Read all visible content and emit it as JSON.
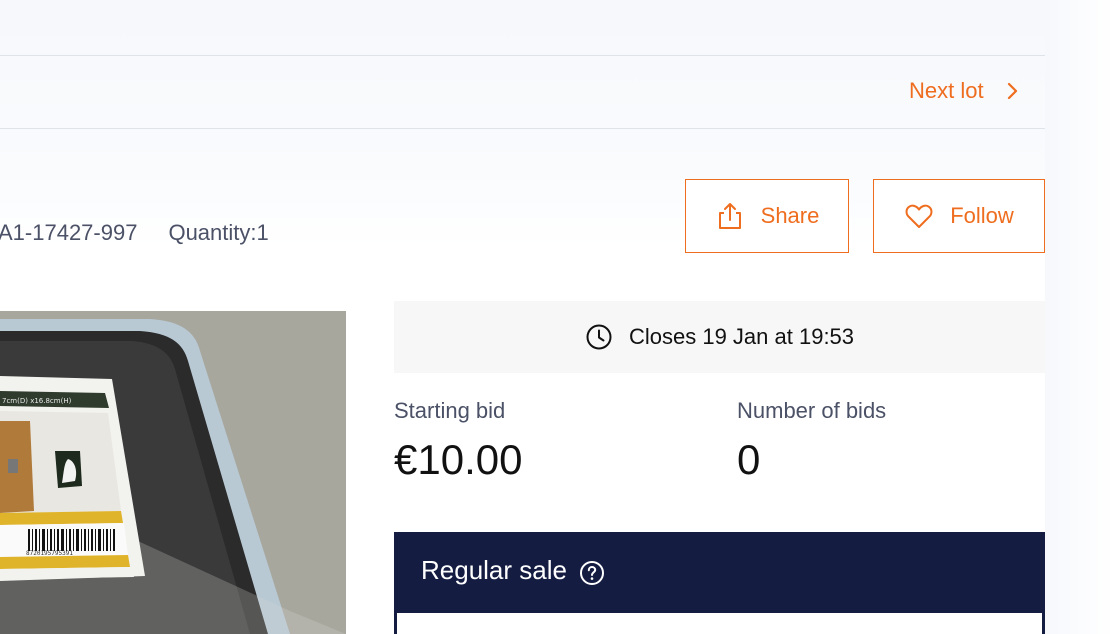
{
  "navigation": {
    "next_lot_label": "Next lot",
    "next_lot_icon": "chevron-right-icon"
  },
  "lot": {
    "reference": "A1-17427-997",
    "quantity": "Quantity:1"
  },
  "actions": {
    "share_label": "Share",
    "share_icon": "share-icon",
    "follow_label": "Follow",
    "follow_icon": "heart-icon"
  },
  "closing": {
    "prefix": "Closes",
    "date_time": "19 Jan at 19:53",
    "icon": "clock-icon"
  },
  "bidding": {
    "starting_bid_label": "Starting bid",
    "starting_bid_value": "€10.00",
    "number_of_bids_label": "Number of bids",
    "number_of_bids_value": "0"
  },
  "sale": {
    "title": "Regular sale",
    "help_icon": "question-circle-icon"
  },
  "colors": {
    "accent": "#ef6d1f",
    "navy": "#141c42",
    "muted_text": "#4b5166",
    "panel_bg": "#f7f7f8"
  },
  "image": {
    "label_text": "7cm(D) x16.8cm(H)",
    "barcode_digits": "8720195795391"
  }
}
